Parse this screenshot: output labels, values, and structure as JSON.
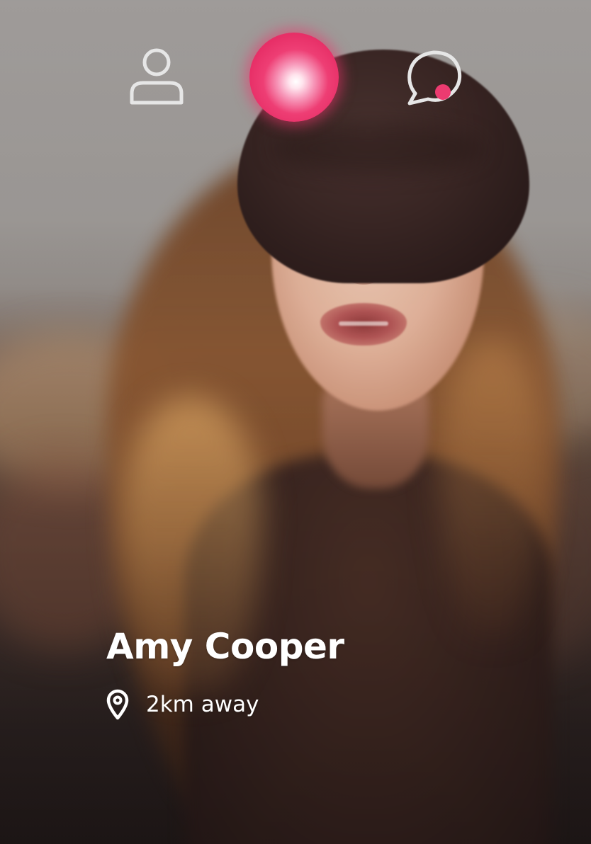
{
  "navigation": {
    "profile_icon": "user-icon",
    "discover_icon": "glowing-orb-icon",
    "messages_icon": "chat-bubble-icon",
    "messages_has_notification": true,
    "accent_color": "#EC3B70",
    "icon_color": "#E6E6E6"
  },
  "profile": {
    "name": "Amy Cooper",
    "location_icon": "map-pin-icon",
    "distance": "2km away"
  }
}
